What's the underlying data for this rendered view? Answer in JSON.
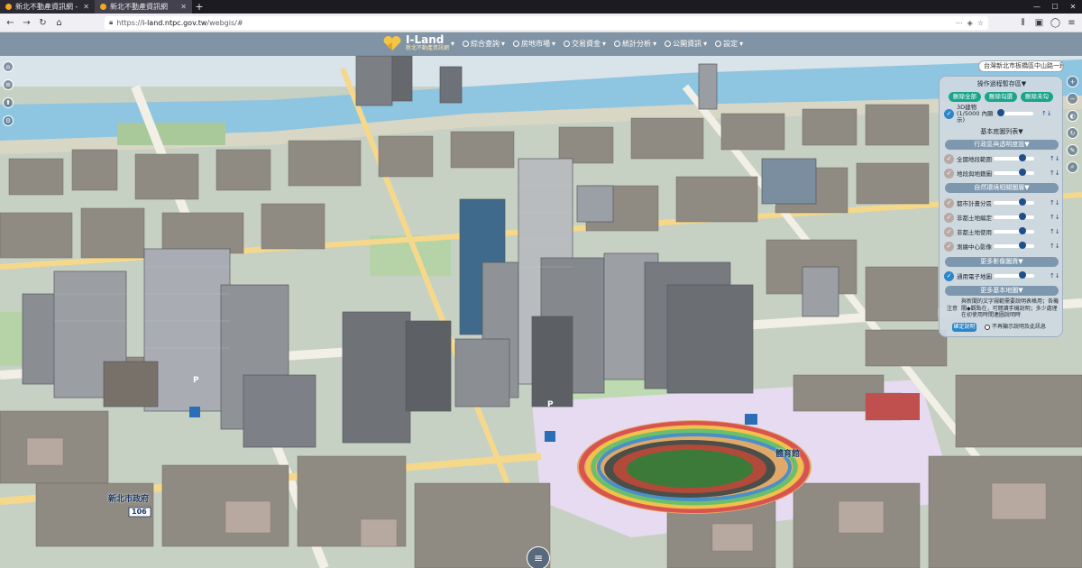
{
  "browser": {
    "tabs": [
      {
        "title": "新北不動產資訊網 - 首頁",
        "active": false
      },
      {
        "title": "新北不動產資訊網",
        "active": true
      }
    ],
    "url_scheme": "https://",
    "url_host": "i-land.ntpc.gov.tw",
    "url_path": "/webgis/#",
    "new_tab_icon": "plus-icon"
  },
  "app": {
    "logo_title": "I-Land",
    "logo_subtitle": "新北不動產資訊網",
    "menus": [
      {
        "label": "綜合查詢",
        "icon": "search-icon"
      },
      {
        "label": "房地市場",
        "icon": "house-icon"
      },
      {
        "label": "交易資金",
        "icon": "money-icon"
      },
      {
        "label": "統計分析",
        "icon": "chart-icon"
      },
      {
        "label": "公開資訊",
        "icon": "info-icon"
      },
      {
        "label": "設定",
        "icon": "gear-icon"
      }
    ],
    "location_search": "台灣新北市板橋區中山路一段段"
  },
  "panel": {
    "header_ops": "操作過程暫存區",
    "btn_delete_all": "刪除全部",
    "btn_delete_checked": "刪除勾選",
    "btn_delete_unchecked": "刪除未勾",
    "row_3d_label": "3D建物(1/5000 內顯示)",
    "header_base": "基本底圖列表",
    "header_admin": "行政區與透明度設",
    "layers_admin": [
      {
        "label": "全國地段範圍",
        "checked": false
      },
      {
        "label": "地段與地籍圖",
        "checked": false
      }
    ],
    "header_nature": "自然環境相關圖層",
    "layers_nature": [
      {
        "label": "都市計畫分區",
        "checked": false
      },
      {
        "label": "非都土地編定",
        "checked": false
      },
      {
        "label": "非都土地使用",
        "checked": false
      },
      {
        "label": "測繪中心影像",
        "checked": false
      }
    ],
    "header_more_img": "更多影像圖資",
    "row_ortho_label": "通用電子地圖",
    "header_more_base": "更多基本地圖",
    "note_label": "注意",
    "note_text": "與新聞的文字規範需要說明表格用；各機關◆觀點在，可閱讀手機說明；多少處理在初使用時間連圖說明時",
    "confirm_label": "確定說明",
    "dont_show_label": "不再顯示說明及此訊息"
  },
  "map_labels": {
    "stadium": "體育館",
    "district": "新北市政府",
    "road_106": "106",
    "sign_park": "P",
    "sign_park2": "P"
  },
  "colors": {
    "appbar": "#6e8296",
    "panel_header": "#7d97ae",
    "green_button": "#1aa58b",
    "river": "#8ec5e0",
    "plaza": "#e6dbf0"
  }
}
